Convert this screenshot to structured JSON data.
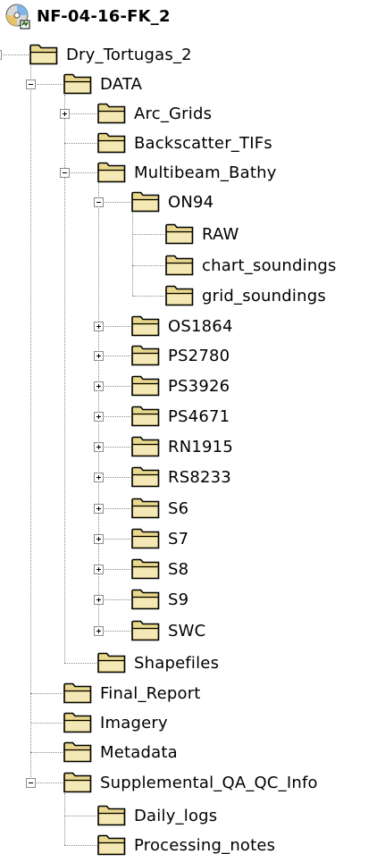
{
  "tree": {
    "root": "NF-04-16-FK_2",
    "nodes": [
      {
        "label": "Dry_Tortugas_2"
      },
      {
        "label": "DATA"
      },
      {
        "label": "Arc_Grids"
      },
      {
        "label": "Backscatter_TIFs"
      },
      {
        "label": "Multibeam_Bathy"
      },
      {
        "label": "ON94"
      },
      {
        "label": "RAW"
      },
      {
        "label": "chart_soundings"
      },
      {
        "label": "grid_soundings"
      },
      {
        "label": "OS1864"
      },
      {
        "label": "PS2780"
      },
      {
        "label": "PS3926"
      },
      {
        "label": "PS4671"
      },
      {
        "label": "RN1915"
      },
      {
        "label": "RS8233"
      },
      {
        "label": "S6"
      },
      {
        "label": "S7"
      },
      {
        "label": "S8"
      },
      {
        "label": "S9"
      },
      {
        "label": "SWC"
      },
      {
        "label": "Shapefiles"
      },
      {
        "label": "Final_Report"
      },
      {
        "label": "Imagery"
      },
      {
        "label": "Metadata"
      },
      {
        "label": "Supplemental_QA_QC_Info"
      },
      {
        "label": "Daily_logs"
      },
      {
        "label": "Processing_notes"
      }
    ]
  },
  "icons": {
    "root": "cd-drive-icon",
    "node": "folder-icon"
  },
  "colors": {
    "folder_fill": "#e9d88e",
    "folder_outline": "#000000",
    "tree_line": "#8a8a8a"
  }
}
